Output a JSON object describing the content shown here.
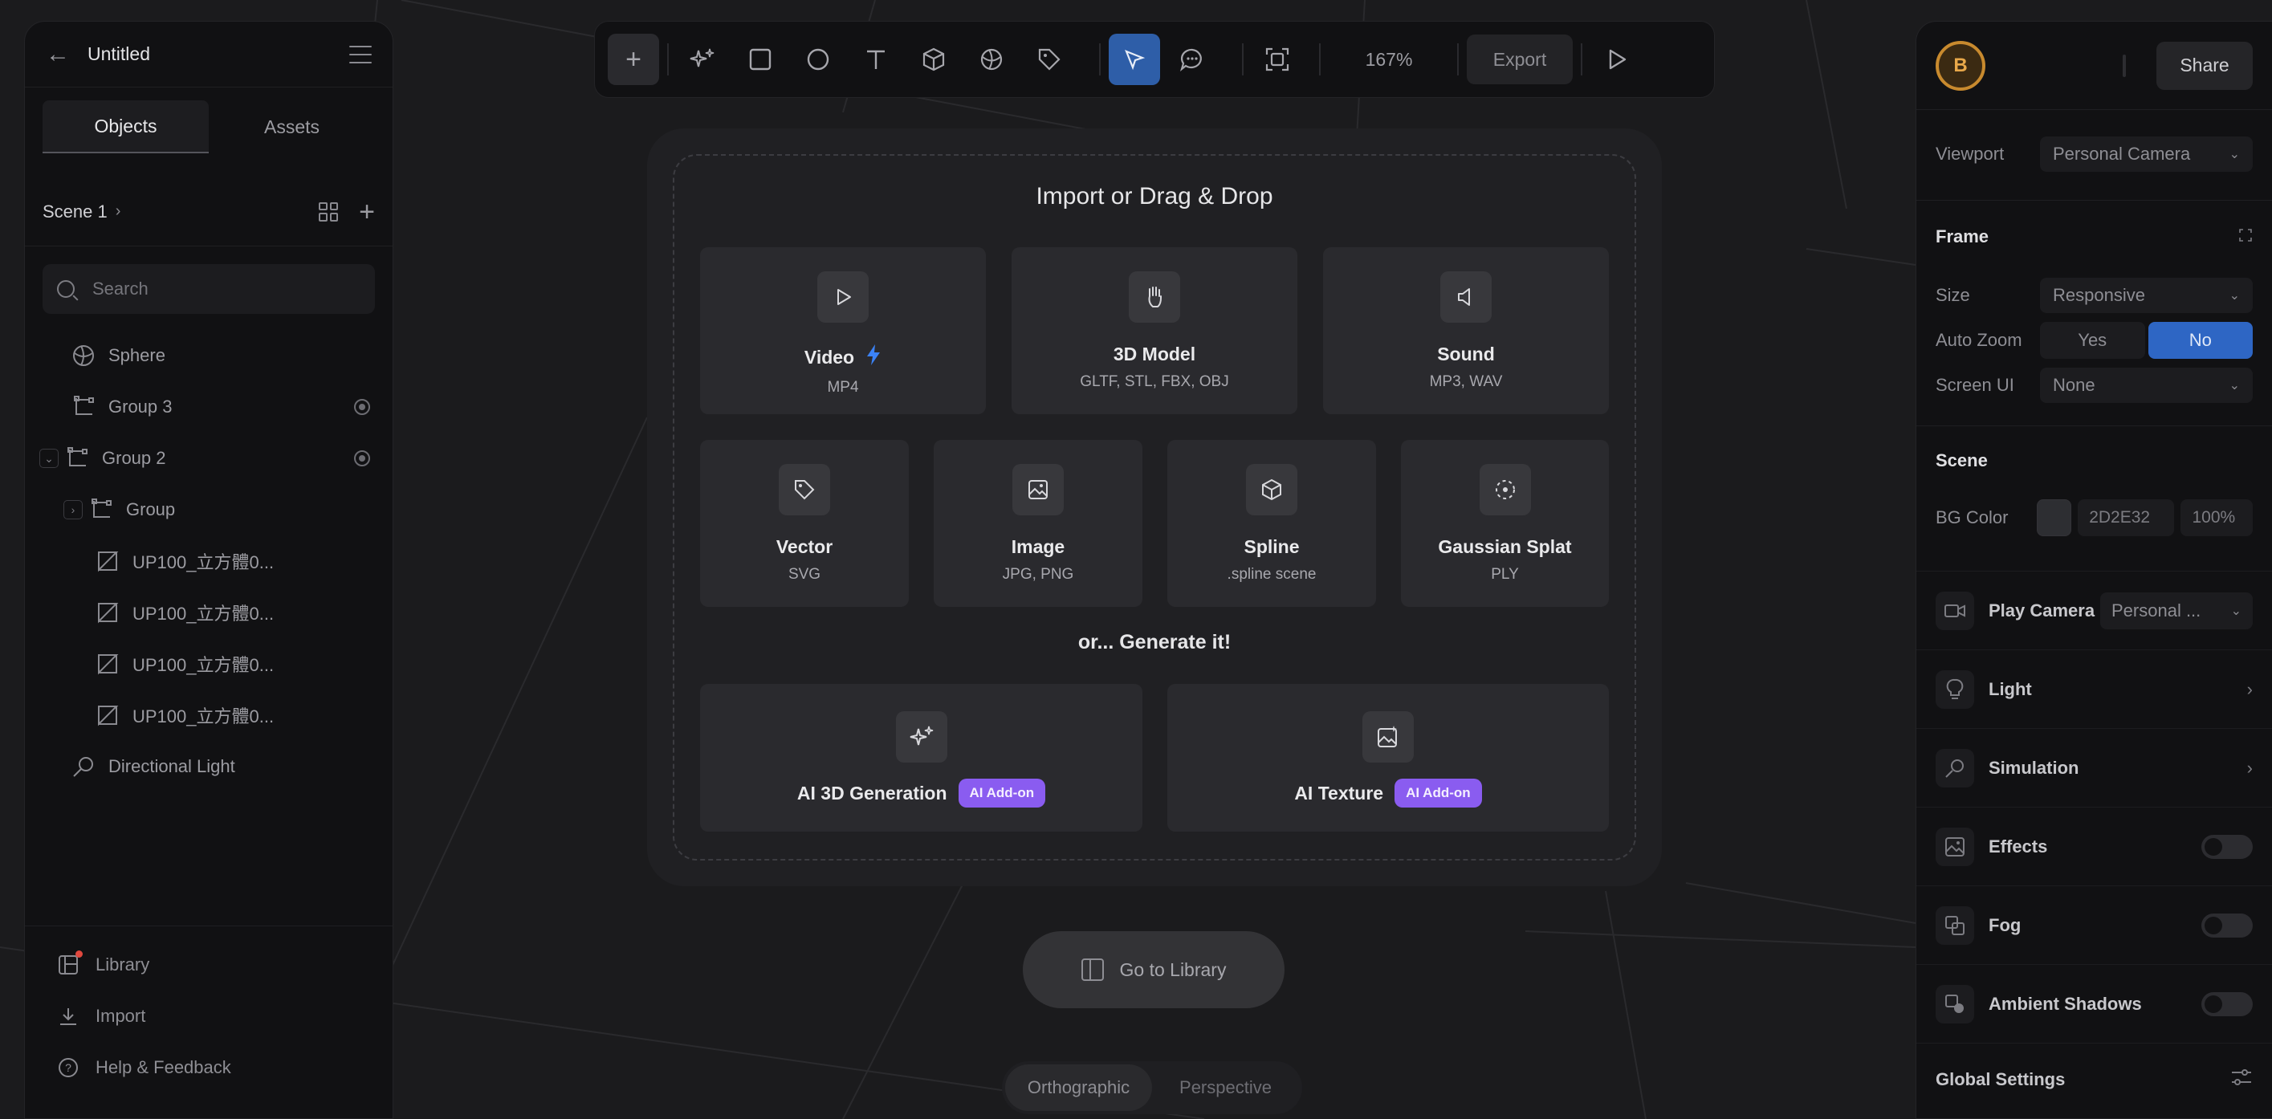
{
  "project": {
    "title": "Untitled"
  },
  "left_panel": {
    "tabs": [
      {
        "label": "Objects"
      },
      {
        "label": "Assets"
      }
    ],
    "scene": {
      "label": "Scene 1"
    },
    "search": {
      "placeholder": "Search"
    },
    "tree": [
      {
        "label": "Sphere",
        "icon": "sphere-icon"
      },
      {
        "label": "Group 3",
        "icon": "group-icon"
      },
      {
        "label": "Group 2",
        "icon": "group-icon"
      },
      {
        "label": "Group",
        "icon": "group-icon"
      },
      {
        "label": "UP100_立方體0...",
        "icon": "shape-icon"
      },
      {
        "label": "UP100_立方體0...",
        "icon": "shape-icon"
      },
      {
        "label": "UP100_立方體0...",
        "icon": "shape-icon"
      },
      {
        "label": "UP100_立方體0...",
        "icon": "shape-icon"
      },
      {
        "label": "Directional Light",
        "icon": "light-icon"
      }
    ],
    "footer": [
      {
        "label": "Library",
        "icon": "library-icon"
      },
      {
        "label": "Import",
        "icon": "import-icon"
      },
      {
        "label": "Help & Feedback",
        "icon": "help-icon"
      }
    ]
  },
  "toolbar": {
    "zoom": "167%",
    "export_label": "Export"
  },
  "right_panel": {
    "share_label": "Share",
    "avatar_letter": "B",
    "viewport": {
      "label": "Viewport",
      "value": "Personal Camera"
    },
    "frame": {
      "title": "Frame",
      "size_label": "Size",
      "size_value": "Responsive",
      "autozoom_label": "Auto Zoom",
      "yes": "Yes",
      "no": "No",
      "screenui_label": "Screen UI",
      "screenui_value": "None"
    },
    "scene": {
      "title": "Scene",
      "bg_label": "BG Color",
      "bg_hex": "2D2E32",
      "bg_opacity": "100%",
      "bg_color": "#2d2e32"
    },
    "items": [
      {
        "label": "Play Camera",
        "value": "Personal ..."
      },
      {
        "label": "Light"
      },
      {
        "label": "Simulation"
      },
      {
        "label": "Effects"
      },
      {
        "label": "Fog"
      },
      {
        "label": "Ambient Shadows"
      },
      {
        "label": "Global Settings"
      }
    ]
  },
  "modal": {
    "title": "Import or Drag & Drop",
    "cards": [
      {
        "name": "Video",
        "sub": "MP4"
      },
      {
        "name": "3D Model",
        "sub": "GLTF, STL, FBX, OBJ"
      },
      {
        "name": "Sound",
        "sub": "MP3, WAV"
      },
      {
        "name": "Vector",
        "sub": "SVG"
      },
      {
        "name": "Image",
        "sub": "JPG, PNG"
      },
      {
        "name": "Spline",
        "sub": ".spline scene"
      },
      {
        "name": "Gaussian Splat",
        "sub": "PLY"
      }
    ],
    "generate_title": "or... Generate it!",
    "gen_cards": [
      {
        "name": "AI 3D Generation",
        "badge": "AI Add-on"
      },
      {
        "name": "AI Texture",
        "badge": "AI Add-on"
      }
    ]
  },
  "library_button": {
    "label": "Go to Library"
  },
  "view_toggle": {
    "orthographic": "Orthographic",
    "perspective": "Perspective"
  },
  "colors": {
    "accent": "#2e66c4",
    "badge": "#8a5cf0",
    "bolt": "#3b82f6"
  }
}
